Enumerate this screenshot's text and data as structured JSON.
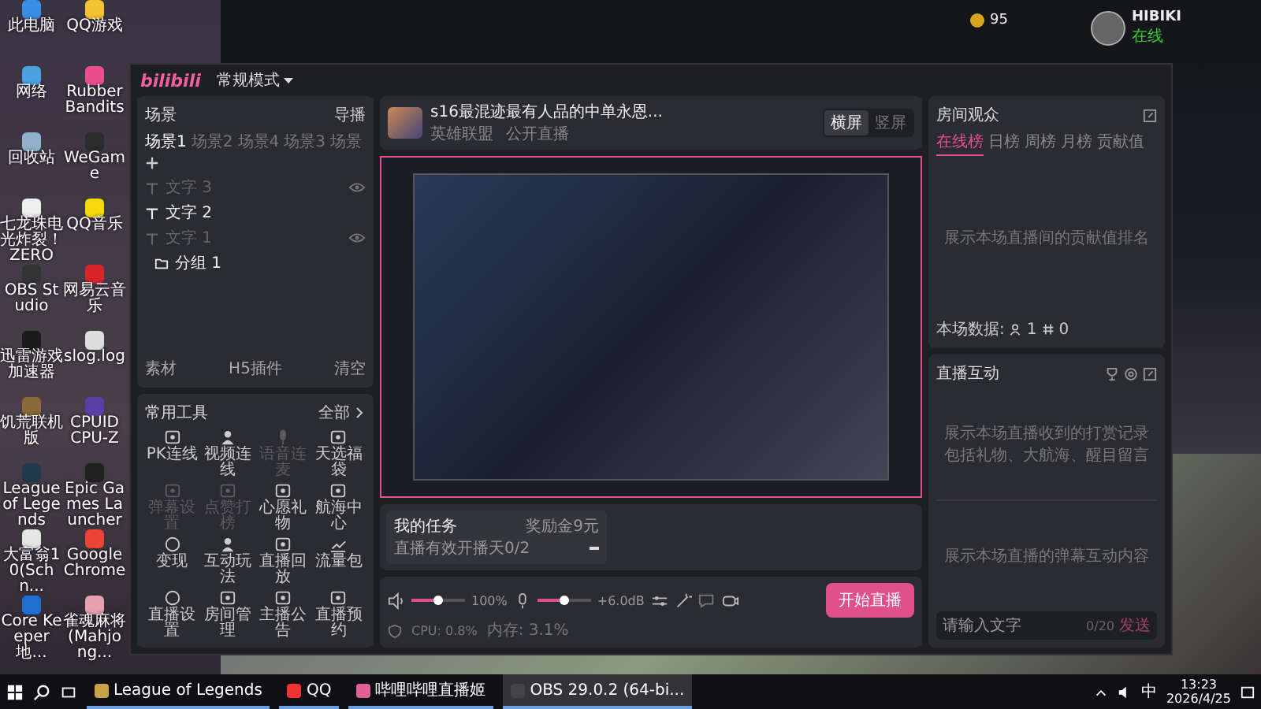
{
  "desktop_icons": [
    {
      "label": "此电脑"
    },
    {
      "label": "QQ游戏"
    },
    {
      "label": "网络"
    },
    {
      "label": "Rubber Bandits"
    },
    {
      "label": "回收站"
    },
    {
      "label": "WeGame"
    },
    {
      "label": "七龙珠电光炸裂！ZERO"
    },
    {
      "label": "QQ音乐"
    },
    {
      "label": "OBS Studio"
    },
    {
      "label": "网易云音乐"
    },
    {
      "label": "迅雷游戏加速器"
    },
    {
      "label": "slog.log"
    },
    {
      "label": "饥荒联机版"
    },
    {
      "label": "CPUID CPU-Z"
    },
    {
      "label": "League of Legends"
    },
    {
      "label": "Epic Games Launcher"
    },
    {
      "label": "大富翁10(Schn..."
    },
    {
      "label": "Google Chrome"
    },
    {
      "label": "Core Keeper 地..."
    },
    {
      "label": "雀魂麻将(Mahjong..."
    }
  ],
  "game_client": {
    "coins": "95",
    "username": "HIBIKI",
    "status": "在线"
  },
  "app": {
    "logo": "bilibili",
    "mode": "常规模式",
    "scenes": {
      "title": "场景",
      "director": "导播",
      "tabs": [
        {
          "label": "场景1",
          "selected": true
        },
        {
          "label": "场景2",
          "selected": false
        },
        {
          "label": "场景4",
          "selected": false
        },
        {
          "label": "场景3",
          "selected": false
        },
        {
          "label": "场景",
          "selected": false
        }
      ],
      "sources": [
        {
          "label": "文字 3",
          "kind": "text",
          "visible": false
        },
        {
          "label": "文字 2",
          "kind": "text",
          "visible": true
        },
        {
          "label": "文字 1",
          "kind": "text",
          "visible": false
        },
        {
          "label": "分组 1",
          "kind": "group",
          "visible": true
        }
      ],
      "footer": [
        "素材",
        "H5插件",
        "清空"
      ]
    },
    "tools": {
      "title": "常用工具",
      "more": "全部",
      "items": [
        {
          "label": "PK连线",
          "disabled": false
        },
        {
          "label": "视频连线",
          "disabled": false
        },
        {
          "label": "语音连麦",
          "disabled": true
        },
        {
          "label": "天选福袋",
          "disabled": false
        },
        {
          "label": "弹幕设置",
          "disabled": true
        },
        {
          "label": "点赞打榜",
          "disabled": true
        },
        {
          "label": "心愿礼物",
          "disabled": false
        },
        {
          "label": "航海中心",
          "disabled": false
        },
        {
          "label": "变现",
          "disabled": false
        },
        {
          "label": "互动玩法",
          "disabled": false
        },
        {
          "label": "直播回放",
          "disabled": false
        },
        {
          "label": "流量包",
          "disabled": false
        },
        {
          "label": "直播设置",
          "disabled": false
        },
        {
          "label": "房间管理",
          "disabled": false
        },
        {
          "label": "主播公告",
          "disabled": false
        },
        {
          "label": "直播预约",
          "disabled": false
        }
      ]
    },
    "stream": {
      "title": "s16最混迹最有人品的中单永恩...",
      "category": "英雄联盟",
      "privacy": "公开直播",
      "orientations": [
        {
          "label": "横屏",
          "selected": true
        },
        {
          "label": "竖屏",
          "selected": false
        }
      ]
    },
    "task": {
      "title": "我的任务",
      "reward": "奖励金9元",
      "progress": "直播有效开播天0/2"
    },
    "audio": {
      "speaker": {
        "level": 0.5,
        "reading": "100%"
      },
      "mic": {
        "level": 0.5,
        "reading": "+6.0dB"
      }
    },
    "stats": {
      "cpu": "CPU: 0.8%",
      "memory": "内存: 3.1%"
    },
    "start_button": "开始直播",
    "audience": {
      "title": "房间观众",
      "tabs": [
        {
          "label": "在线榜",
          "selected": true
        },
        {
          "label": "日榜",
          "selected": false
        },
        {
          "label": "周榜",
          "selected": false
        },
        {
          "label": "月榜",
          "selected": false
        },
        {
          "label": "贡献值",
          "selected": false
        }
      ],
      "empty": "展示本场直播间的贡献值排名",
      "stats_label": "本场数据:",
      "viewers": "1",
      "likes": "0"
    },
    "interaction": {
      "title": "直播互动",
      "gifts_empty": "展示本场直播收到的打赏记录包括礼物、大航海、醒目留言",
      "danmaku_empty": "展示本场直播的弹幕互动内容",
      "input": {
        "placeholder": "请输入文字",
        "counter": "0/20",
        "send": "发送"
      }
    }
  },
  "taskbar": {
    "apps": [
      {
        "label": "League of Legends",
        "selected": false
      },
      {
        "label": "QQ",
        "selected": false
      },
      {
        "label": "哔哩哔哩直播姬",
        "selected": false
      },
      {
        "label": "OBS 29.0.2 (64-bi...",
        "selected": true
      }
    ],
    "ime": "中",
    "time": "13:23",
    "date": "2026/4/25"
  }
}
